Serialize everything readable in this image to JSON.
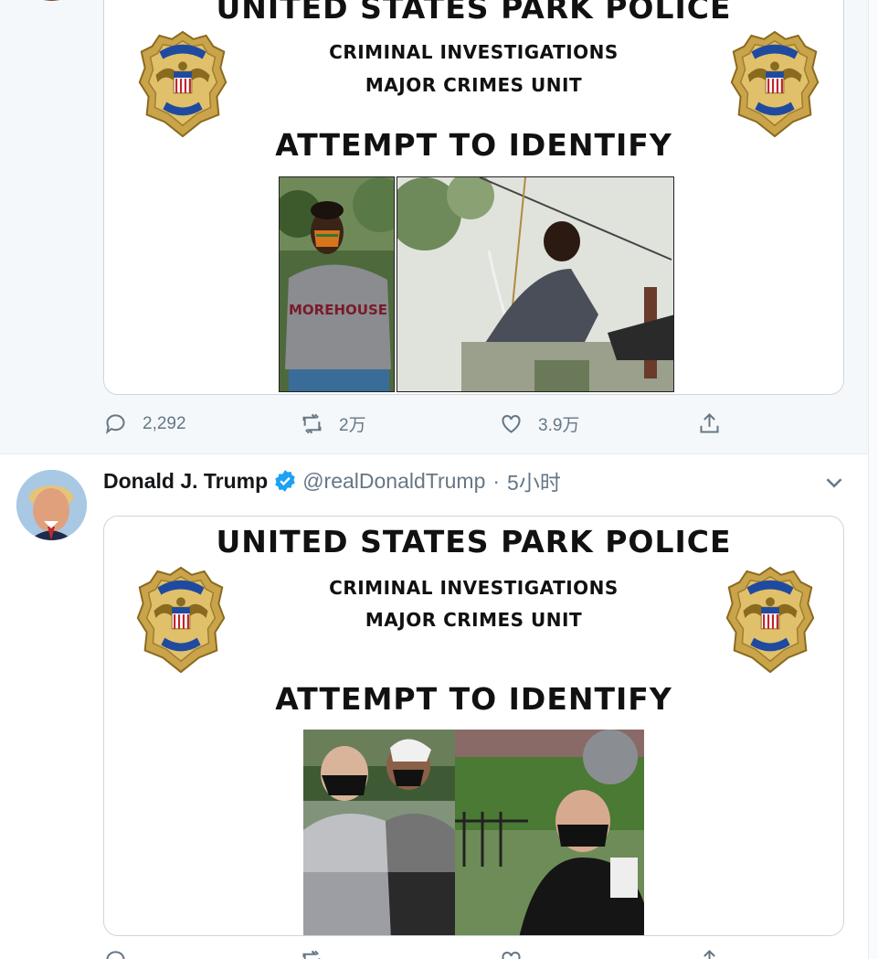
{
  "tweets": [
    {
      "poster": {
        "agency": "UNITED STATES PARK POLICE",
        "division": "CRIMINAL INVESTIGATIONS",
        "unit": "MAJOR CRIMES UNIT",
        "headline": "ATTEMPT TO IDENTIFY",
        "shirt_text": "MOREHOUSE"
      },
      "actions": {
        "replies": "2,292",
        "retweets": "2万",
        "likes": "3.9万"
      }
    },
    {
      "author": {
        "name": "Donald J. Trump",
        "handle": "@realDonaldTrump",
        "separator": "·",
        "time": "5小时"
      },
      "poster": {
        "agency": "UNITED STATES PARK POLICE",
        "division": "CRIMINAL INVESTIGATIONS",
        "unit": "MAJOR CRIMES UNIT",
        "headline": "ATTEMPT TO IDENTIFY"
      }
    }
  ],
  "icons": {
    "reply": "speech-bubble-icon",
    "retweet": "retweet-arrows-icon",
    "like": "heart-icon",
    "share": "share-upload-icon",
    "verified": "verified-badge-icon",
    "more": "chevron-down-icon"
  },
  "colors": {
    "verified": "#1da1f2",
    "muted": "#657786",
    "hover_bg": "#f5f8fa",
    "border": "#ccd6dd"
  }
}
